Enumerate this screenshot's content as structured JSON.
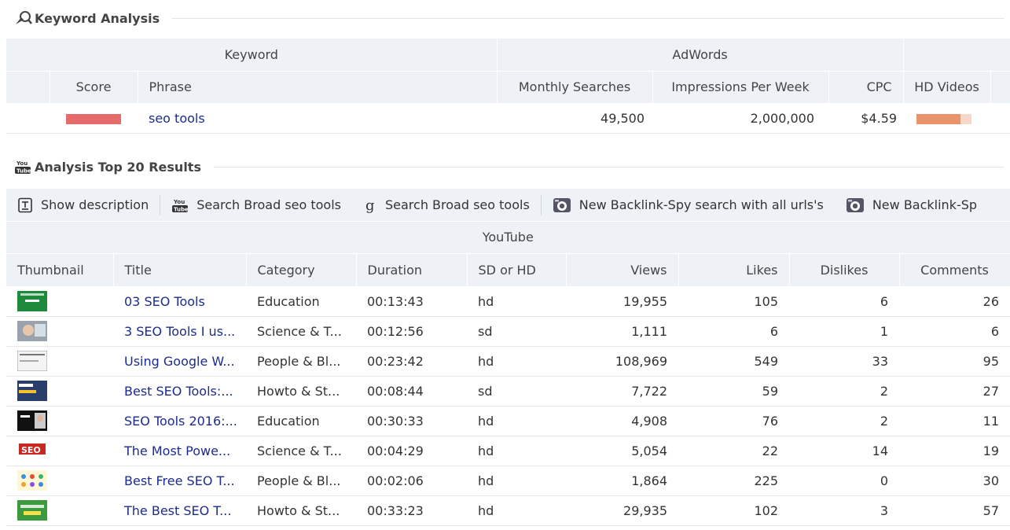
{
  "keyword_section": {
    "title": "Keyword Analysis",
    "group_headers": {
      "keyword": "Keyword",
      "adwords": "AdWords"
    },
    "columns": {
      "score": "Score",
      "phrase": "Phrase",
      "monthly_searches": "Monthly Searches",
      "impressions": "Impressions Per Week",
      "cpc": "CPC",
      "hd_videos": "HD Videos"
    },
    "row": {
      "phrase": "seo tools",
      "monthly_searches": "49,500",
      "impressions": "2,000,000",
      "cpc": "$4.59",
      "hd_videos_fraction": 0.8
    },
    "colors": {
      "score_bar": "#e56a6a",
      "hd_bar": "#e8936a",
      "hd_bar_bg": "#f7d8c8"
    }
  },
  "results_section": {
    "title": "Analysis Top 20 Results",
    "toolbar": [
      {
        "icon": "document-icon",
        "label": "Show description"
      },
      {
        "icon": "youtube-icon",
        "label": "Search Broad seo tools"
      },
      {
        "icon": "google-icon",
        "label": "Search Broad seo tools"
      },
      {
        "icon": "backlink-spy-icon",
        "label": "New Backlink-Spy search with all urls's"
      },
      {
        "icon": "backlink-spy-icon",
        "label": "New Backlink-Sp"
      }
    ],
    "group_header": "YouTube",
    "columns": {
      "thumbnail": "Thumbnail",
      "title": "Title",
      "category": "Category",
      "duration": "Duration",
      "sd_hd": "SD or HD",
      "views": "Views",
      "likes": "Likes",
      "dislikes": "Dislikes",
      "comments": "Comments"
    },
    "rows": [
      {
        "title": "03 SEO Tools",
        "category": "Education",
        "duration": "00:13:43",
        "quality": "hd",
        "views": "19,955",
        "likes": "105",
        "dislikes": "6",
        "comments": "26"
      },
      {
        "title": "3 SEO Tools I us...",
        "category": "Science & T...",
        "duration": "00:12:56",
        "quality": "sd",
        "views": "1,111",
        "likes": "6",
        "dislikes": "1",
        "comments": "6"
      },
      {
        "title": "Using Google W...",
        "category": "People & Bl...",
        "duration": "00:23:42",
        "quality": "hd",
        "views": "108,969",
        "likes": "549",
        "dislikes": "33",
        "comments": "95"
      },
      {
        "title": "Best SEO Tools:...",
        "category": "Howto & St...",
        "duration": "00:08:44",
        "quality": "sd",
        "views": "7,722",
        "likes": "59",
        "dislikes": "2",
        "comments": "27"
      },
      {
        "title": "SEO Tools 2016:...",
        "category": "Education",
        "duration": "00:30:33",
        "quality": "hd",
        "views": "4,908",
        "likes": "76",
        "dislikes": "2",
        "comments": "11"
      },
      {
        "title": "The Most Powe...",
        "category": "Science & T...",
        "duration": "00:04:29",
        "quality": "hd",
        "views": "5,054",
        "likes": "22",
        "dislikes": "14",
        "comments": "19"
      },
      {
        "title": "Best Free SEO T...",
        "category": "People & Bl...",
        "duration": "00:02:06",
        "quality": "hd",
        "views": "1,864",
        "likes": "225",
        "dislikes": "0",
        "comments": "30"
      },
      {
        "title": "The Best SEO T...",
        "category": "Howto & St...",
        "duration": "00:33:23",
        "quality": "hd",
        "views": "29,935",
        "likes": "102",
        "dislikes": "3",
        "comments": "57"
      }
    ]
  }
}
